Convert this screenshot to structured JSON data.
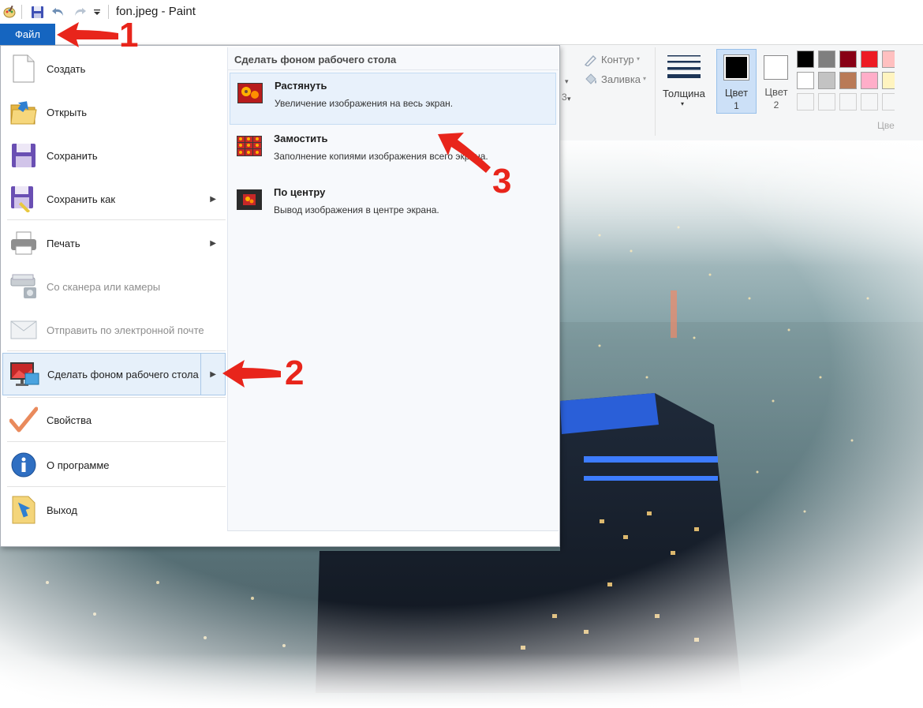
{
  "window": {
    "title": "fon.jpeg - Paint"
  },
  "quick_access": {
    "icons": [
      "paint-icon",
      "save-icon",
      "undo-icon",
      "redo-icon",
      "customize-dropdown-icon"
    ]
  },
  "file_tab": {
    "label": "Файл"
  },
  "ribbon": {
    "outline_label": "Контур",
    "fill_label": "Заливка",
    "thickness_label": "Толщина",
    "color1_label": "Цвет",
    "color1_num": "1",
    "color2_label": "Цвет",
    "color2_num": "2",
    "colors_group_partial": "Цве"
  },
  "palette": {
    "row1": [
      "#000000",
      "#7f7f7f",
      "#880015",
      "#ed1c24",
      "#ffc0c0"
    ],
    "row2": [
      "#ffffff",
      "#c3c3c3",
      "#b97a57",
      "#ffaec9",
      "#fff4c0"
    ],
    "row3": [
      "#ffffff",
      "#ffffff",
      "#ffffff",
      "#ffffff",
      "#ffffff"
    ],
    "color1_value": "#000000",
    "color2_value": "#ffffff"
  },
  "file_menu": {
    "items": [
      {
        "label": "Создать",
        "icon": "new-file-icon"
      },
      {
        "label": "Открыть",
        "icon": "open-folder-icon"
      },
      {
        "label": "Сохранить",
        "icon": "save-icon"
      },
      {
        "label": "Сохранить как",
        "icon": "save-as-icon"
      },
      {
        "label": "Печать",
        "icon": "printer-icon"
      },
      {
        "label": "Со сканера или камеры",
        "icon": "scanner-camera-icon"
      },
      {
        "label": "Отправить по электронной почте",
        "icon": "email-icon"
      },
      {
        "label": "Сделать фоном рабочего стола",
        "icon": "desktop-background-icon"
      },
      {
        "label": "Свойства",
        "icon": "checkmark-icon"
      },
      {
        "label": "О программе",
        "icon": "info-icon"
      },
      {
        "label": "Выход",
        "icon": "exit-icon"
      }
    ]
  },
  "submenu": {
    "title": "Сделать фоном рабочего стола",
    "items": [
      {
        "title": "Растянуть",
        "description": "Увеличение изображения на весь экран."
      },
      {
        "title": "Замостить",
        "description": "Заполнение копиями изображения всего экрана."
      },
      {
        "title": "По центру",
        "description": "Вывод изображения в центре экрана."
      }
    ]
  },
  "annotations": {
    "step1": "1",
    "step2": "2",
    "step3": "3",
    "color": "#e8251b"
  }
}
